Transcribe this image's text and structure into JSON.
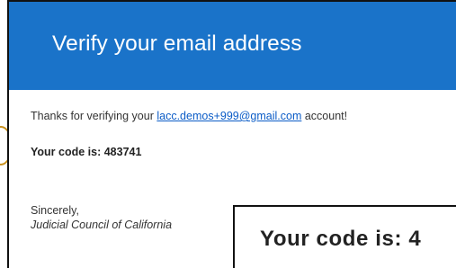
{
  "email": {
    "title": "Verify your email address",
    "thanks_prefix": "Thanks for verifying your ",
    "email_link": "lacc.demos+999@gmail.com",
    "thanks_suffix": " account!",
    "code_text": "Your code is: 483741",
    "closing": "Sincerely,",
    "signature": "Judicial Council of California"
  },
  "callout": {
    "text": "Your code is: 4"
  },
  "colors": {
    "banner": "#1a73c9",
    "link": "#0b5cc7",
    "highlight": "#c88f1a"
  }
}
